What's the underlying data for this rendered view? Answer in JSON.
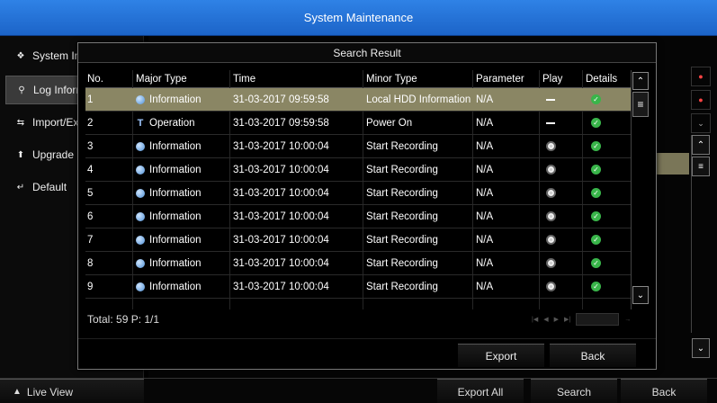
{
  "window": {
    "title": "System Maintenance"
  },
  "sidebar": {
    "items": [
      {
        "label": "System In",
        "icon": "info-icon"
      },
      {
        "label": "Log Inform",
        "icon": "log-search-icon"
      },
      {
        "label": "Import/Exp",
        "icon": "import-export-icon"
      },
      {
        "label": "Upgrade",
        "icon": "upgrade-arrow-icon"
      },
      {
        "label": "Default",
        "icon": "default-return-icon"
      }
    ]
  },
  "bottombar": {
    "live_view": "Live View",
    "export_all": "Export All",
    "search": "Search",
    "back": "Back"
  },
  "dialog": {
    "title": "Search Result",
    "columns": [
      "No.",
      "Major Type",
      "Time",
      "Minor Type",
      "Parameter",
      "Play",
      "Details"
    ],
    "rows": [
      {
        "no": "1",
        "major": "Information",
        "time": "31-03-2017 09:59:58",
        "minor": "Local HDD Information",
        "param": "N/A",
        "play": "none",
        "selected": true
      },
      {
        "no": "2",
        "major": "Operation",
        "time": "31-03-2017 09:59:58",
        "minor": "Power On",
        "param": "N/A",
        "play": "none",
        "selected": false
      },
      {
        "no": "3",
        "major": "Information",
        "time": "31-03-2017 10:00:04",
        "minor": "Start Recording",
        "param": "N/A",
        "play": "play",
        "selected": false
      },
      {
        "no": "4",
        "major": "Information",
        "time": "31-03-2017 10:00:04",
        "minor": "Start Recording",
        "param": "N/A",
        "play": "play",
        "selected": false
      },
      {
        "no": "5",
        "major": "Information",
        "time": "31-03-2017 10:00:04",
        "minor": "Start Recording",
        "param": "N/A",
        "play": "play",
        "selected": false
      },
      {
        "no": "6",
        "major": "Information",
        "time": "31-03-2017 10:00:04",
        "minor": "Start Recording",
        "param": "N/A",
        "play": "play",
        "selected": false
      },
      {
        "no": "7",
        "major": "Information",
        "time": "31-03-2017 10:00:04",
        "minor": "Start Recording",
        "param": "N/A",
        "play": "play",
        "selected": false
      },
      {
        "no": "8",
        "major": "Information",
        "time": "31-03-2017 10:00:04",
        "minor": "Start Recording",
        "param": "N/A",
        "play": "play",
        "selected": false
      },
      {
        "no": "9",
        "major": "Information",
        "time": "31-03-2017 10:00:04",
        "minor": "Start Recording",
        "param": "N/A",
        "play": "play",
        "selected": false
      }
    ],
    "footer": "Total: 59  P: 1/1",
    "export_label": "Export",
    "back_label": "Back"
  },
  "colors": {
    "title_bar": "#2f82e6",
    "selected_row": "#8a8664",
    "details_ok": "#39b54a"
  }
}
